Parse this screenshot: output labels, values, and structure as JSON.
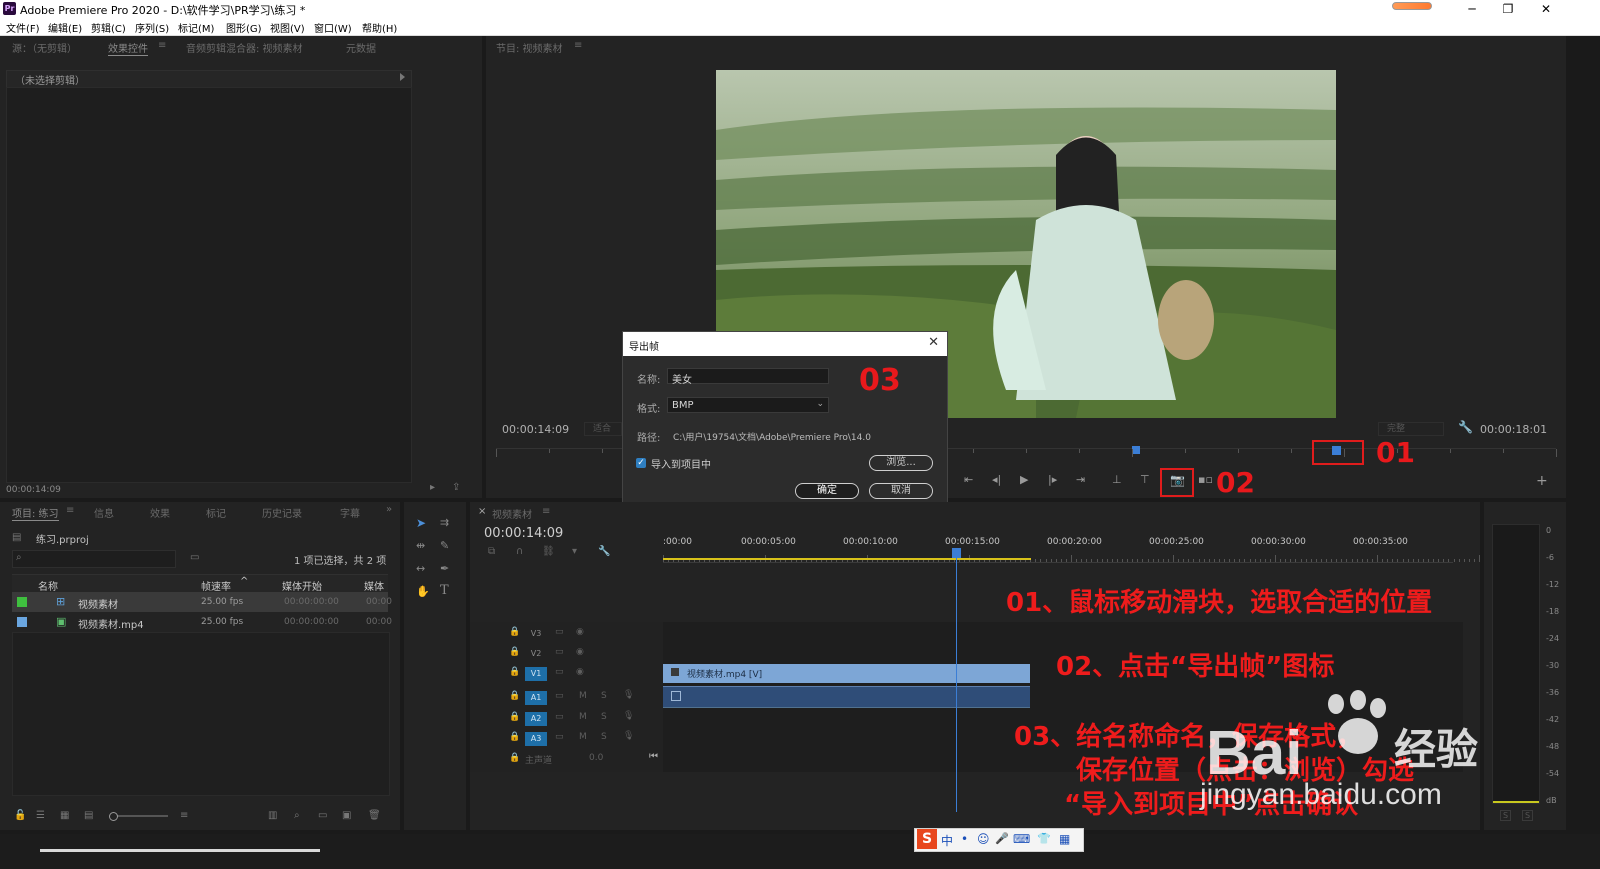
{
  "window": {
    "title": "Adobe Premiere Pro 2020 - D:\\软件学习\\PR学习\\练习 *",
    "app_icon": "Pr",
    "controls": [
      "minimize-icon",
      "restore-icon",
      "close-icon"
    ],
    "control_glyphs": {
      "min": "─",
      "restore": "❐",
      "close": "✕"
    }
  },
  "menu": [
    "文件(F)",
    "编辑(E)",
    "剪辑(C)",
    "序列(S)",
    "标记(M)",
    "图形(G)",
    "视图(V)",
    "窗口(W)",
    "帮助(H)"
  ],
  "source_panel": {
    "tabs": [
      "源：（无剪辑）",
      "效果控件",
      "音频剪辑混合器: 视频素材",
      "元数据"
    ],
    "active_tab": "效果控件",
    "menu_glyph": "≡",
    "no_clip": "（未选择剪辑）",
    "timecode": "00:00:14:09"
  },
  "program_monitor": {
    "tab": "节目: 视频素材",
    "timecode_left": "00:00:14:09",
    "fit_label": "适合",
    "quality_label": "完整",
    "timecode_right": "00:00:18:01",
    "playhead_fraction": 0.6
  },
  "export_dialog": {
    "title": "导出帧",
    "name_label": "名称:",
    "name_value": "美女",
    "format_label": "格式:",
    "format_value": "BMP",
    "path_label": "路径:",
    "path_value": "C:\\用户\\19754\\文档\\Adobe\\Premiere Pro\\14.0",
    "import_checkbox_label": "导入到项目中",
    "import_checked": true,
    "browse_button": "浏览...",
    "ok_button": "确定",
    "cancel_button": "取消"
  },
  "project_panel": {
    "tabs": [
      "项目: 练习",
      "信息",
      "效果",
      "标记",
      "历史记录",
      "字幕"
    ],
    "overflow_glyph": "»",
    "project_file": "练习.prproj",
    "selection_info": "1 项已选择，共 2 项",
    "columns": [
      "名称",
      "帧速率",
      "媒体开始",
      "媒体"
    ],
    "rows": [
      {
        "color": "#3fbf3f",
        "name": "视频素材",
        "fps": "25.00 fps",
        "start": "00:00:00:00",
        "media": "00:00"
      },
      {
        "color": "#6aa6e0",
        "name": "视频素材.mp4",
        "fps": "25.00 fps",
        "start": "00:00:00:00",
        "media": "00:00"
      }
    ]
  },
  "timeline": {
    "tab": "视频素材",
    "timecode": "00:00:14:09",
    "ruler": [
      ":00:00",
      "00:00:05:00",
      "00:00:10:00",
      "00:00:15:00",
      "00:00:20:00",
      "00:00:25:00",
      "00:00:30:00",
      "00:00:35:00"
    ],
    "tracks_video": [
      "V3",
      "V2",
      "V1"
    ],
    "tracks_audio": [
      "A1",
      "A2",
      "A3"
    ],
    "master_label": "主声道",
    "master_value": "0.0",
    "clip_label": "视频素材.mp4 [V]",
    "track_mute": "M",
    "track_solo": "S",
    "playhead_seconds": 14.36
  },
  "audio_meter": {
    "labels": [
      "0",
      "-6",
      "-12",
      "-18",
      "-24",
      "-30",
      "-36",
      "-42",
      "-48",
      "-54",
      "dB"
    ],
    "solo_labels": [
      "S",
      "S"
    ]
  },
  "annotations": {
    "label_01": "01",
    "label_02": "02",
    "label_03": "03",
    "step1": "01、鼠标移动滑块，选取合适的位置",
    "step2": "02、点击“导出帧”图标",
    "step3_line1": "03、给名称命名，保存格式，",
    "step3_line2": "保存位置（点击：浏览）勾选",
    "step3_line3": "“导入到项目中”点击确认"
  },
  "watermark": {
    "brand": "Bai",
    "brand_cn": "经验",
    "site": "jingyan.baidu.com"
  },
  "ime_bar": {
    "logo": "S",
    "items": [
      "中",
      "•",
      "☺",
      "🎤",
      "⌨",
      "👕",
      "▦"
    ]
  },
  "colors": {
    "accent_blue": "#2f7fc1",
    "annotation_red": "#e8191c",
    "clip_blue": "#7da6d6"
  }
}
